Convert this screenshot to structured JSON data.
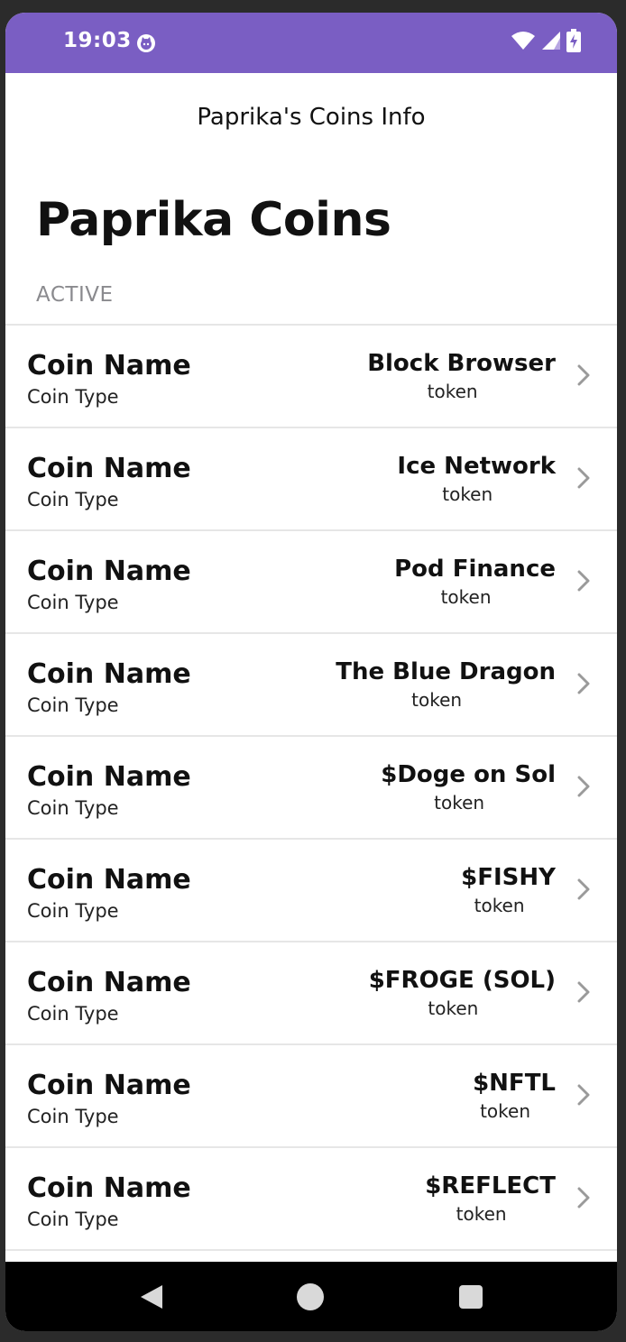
{
  "status_bar": {
    "time": "19:03",
    "app_icon": "cat-face-icon",
    "wifi_icon": "wifi-icon",
    "signal_icon": "cell-signal-icon",
    "battery_icon": "battery-charging-icon",
    "background_color": "#7a5ec3"
  },
  "appbar": {
    "title": "Paprika's Coins Info"
  },
  "page": {
    "large_title": "Paprika Coins",
    "section_header": "ACTIVE"
  },
  "rows": [
    {
      "label": "Coin Name",
      "sublabel": "Coin Type",
      "name": "Block Browser",
      "type": "token"
    },
    {
      "label": "Coin Name",
      "sublabel": "Coin Type",
      "name": "Ice Network",
      "type": "token"
    },
    {
      "label": "Coin Name",
      "sublabel": "Coin Type",
      "name": "Pod Finance",
      "type": "token"
    },
    {
      "label": "Coin Name",
      "sublabel": "Coin Type",
      "name": "The Blue Dragon",
      "type": "token"
    },
    {
      "label": "Coin Name",
      "sublabel": "Coin Type",
      "name": "$Doge on Sol",
      "type": "token"
    },
    {
      "label": "Coin Name",
      "sublabel": "Coin Type",
      "name": "$FISHY",
      "type": "token"
    },
    {
      "label": "Coin Name",
      "sublabel": "Coin Type",
      "name": "$FROGE (SOL)",
      "type": "token"
    },
    {
      "label": "Coin Name",
      "sublabel": "Coin Type",
      "name": "$NFTL",
      "type": "token"
    },
    {
      "label": "Coin Name",
      "sublabel": "Coin Type",
      "name": "$REFLECT",
      "type": "token"
    }
  ],
  "navbar": {
    "back_icon": "back-triangle-icon",
    "home_icon": "home-circle-icon",
    "recents_icon": "recents-square-icon"
  }
}
